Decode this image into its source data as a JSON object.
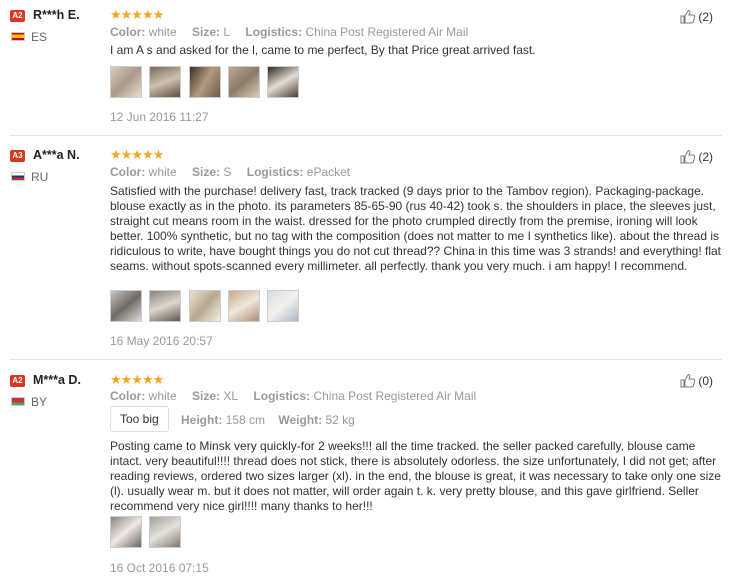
{
  "reviews": [
    {
      "level": "A2",
      "name": "R***h E.",
      "country": "ES",
      "stars": "★★★★★",
      "color_label": "Color:",
      "color": "white",
      "size_label": "Size:",
      "size": "L",
      "logistics_label": "Logistics:",
      "logistics": "China Post Registered Air Mail",
      "helpful": "(2)",
      "text": "I am A s and asked for the l, came to me perfect, By that Price great arrived fast.",
      "photos": [
        "photo-1",
        "photo-2",
        "photo-3",
        "photo-4",
        "photo-5"
      ],
      "date": "12 Jun 2016 11:27"
    },
    {
      "level": "A3",
      "name": "A***a N.",
      "country": "RU",
      "stars": "★★★★★",
      "color_label": "Color:",
      "color": "white",
      "size_label": "Size:",
      "size": "S",
      "logistics_label": "Logistics:",
      "logistics": "ePacket",
      "helpful": "(2)",
      "text": "Satisfied with the purchase! delivery fast, track tracked (9 days prior to the Tambov region). Packaging-package. blouse exactly as in the photo. its parameters 85-65-90 (rus 40-42) took s. the shoulders in place, the sleeves just, straight cut means room in the waist. dressed for the photo crumpled directly from the premise, ironing will look better. 100% synthetic, but no tag with the composition (does not matter to me I synthetics like). about the thread is ridiculous to write, have bought things you do not cut thread?? China in this time was 3 strands! and everything! flat seams. without spots-scanned every millimeter. all perfectly. thank you very much. i am happy! I recommend.",
      "photos": [
        "photo-1",
        "photo-2",
        "photo-3",
        "photo-4",
        "photo-5"
      ],
      "date": "16 May 2016 20:57"
    },
    {
      "level": "A2",
      "name": "M***a D.",
      "country": "BY",
      "stars": "★★★★★",
      "color_label": "Color:",
      "color": "white",
      "size_label": "Size:",
      "size": "XL",
      "logistics_label": "Logistics:",
      "logistics": "China Post Registered Air Mail",
      "helpful": "(0)",
      "fit_tag": "Too big",
      "height_label": "Height:",
      "height": "158 cm",
      "weight_label": "Weight:",
      "weight": "52 kg",
      "text": "Posting came to Minsk very quickly-for 2 weeks!!! all the time tracked. the seller packed carefully, blouse came intact. very beautiful!!!! thread does not stick, there is absolutely odorless. the size unfortunately, I did not get; after reading reviews, ordered two sizes larger (xl). in the end, the blouse is great, it was necessary to take only one size (l). usually wear m. but it does not matter, will order again t. k. very pretty blouse, and this gave girlfriend. Seller recommend very nice girl!!!! many thanks to her!!!",
      "photos": [
        "photo-1",
        "photo-2"
      ],
      "date": "16 Oct 2016 07:15"
    }
  ],
  "colors": {
    "star": "#f5a623",
    "badge": "#d9381e",
    "muted": "#999999"
  }
}
